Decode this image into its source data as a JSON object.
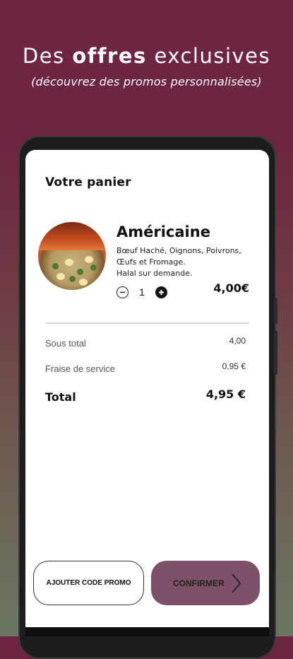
{
  "promo": {
    "title_prefix": "Des",
    "title_bold": "offres",
    "title_suffix": "exclusives",
    "subtitle": "(découvrez des promos personnalisées)"
  },
  "cart": {
    "title": "Votre panier",
    "item": {
      "name": "Américaine",
      "description_lines": [
        "Bœuf Haché, Oignons, Poivrons,",
        "Œufs et Fromage.",
        "Halal sur demande."
      ],
      "quantity": "1",
      "price": "4,00€"
    },
    "summary": {
      "subtotal_label": "Sous total",
      "subtotal_value": "4,00",
      "fee_label": "Fraise de service",
      "fee_value": "0,95 €",
      "total_label": "Total",
      "total_value": "4,95 €"
    },
    "buttons": {
      "promo_label": "AJOUTER CODE PROMO",
      "confirm_label": "CONFIRMER"
    }
  },
  "colors": {
    "background_top": "#6d2541",
    "background_bottom": "#6b7762",
    "confirm_button": "#7f5168"
  },
  "icons": {
    "minus": "minus-circle-icon",
    "plus": "plus-circle-icon",
    "chevron": "chevron-right-icon"
  }
}
